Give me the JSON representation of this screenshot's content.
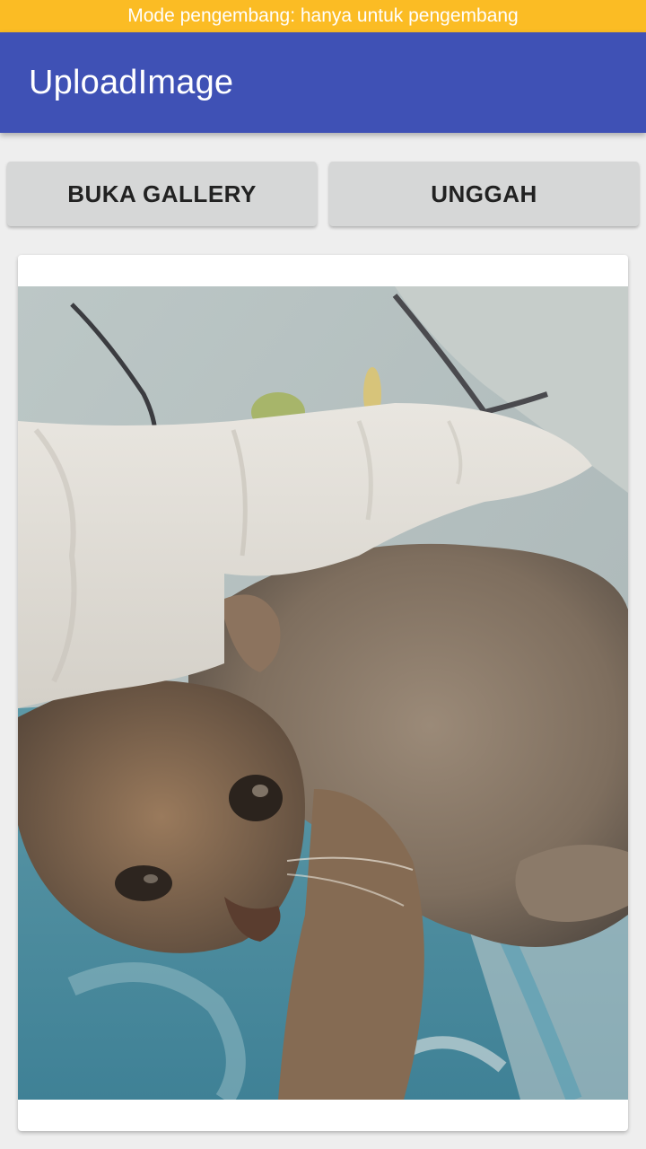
{
  "status_bar": {
    "text": "Mode pengembang: hanya untuk pengembang",
    "color": "#fbbc24"
  },
  "app_bar": {
    "title": "UploadImage",
    "color": "#3f51b5"
  },
  "buttons": {
    "open_gallery": "BUKA GALLERY",
    "upload": "UNGGAH"
  },
  "image_view": {
    "content": "photo-of-kitten-under-blanket"
  }
}
